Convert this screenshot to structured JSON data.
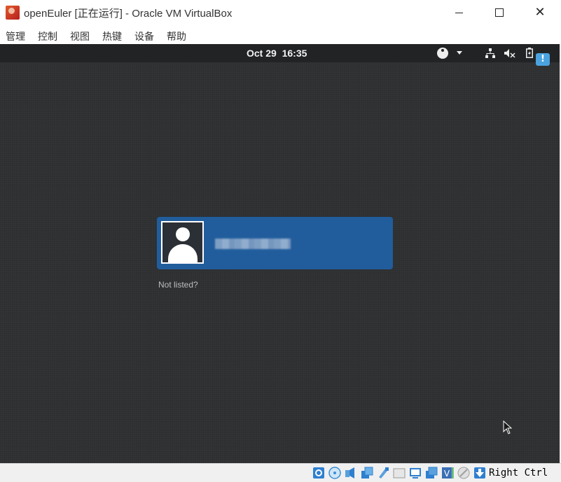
{
  "window": {
    "title": "openEuler [正在运行] - Oracle VM VirtualBox",
    "app_icon": "virtualbox-icon",
    "controls": [
      "minimize-icon",
      "maximize-icon",
      "close-icon"
    ],
    "close_glyph": "✕"
  },
  "menu": {
    "items": [
      "管理",
      "控制",
      "视图",
      "热键",
      "设备",
      "帮助"
    ]
  },
  "guest": {
    "top_bar": {
      "datetime": "Oct 29  16:35",
      "indicators": [
        "accessibility-icon",
        "network-icon",
        "volume-muted-icon",
        "battery-icon"
      ],
      "notification_badge": "!"
    },
    "login": {
      "user_name": "",
      "avatar": "user-avatar-icon",
      "not_listed": "Not listed?"
    },
    "colors": {
      "background": "#2d2f31",
      "top_bar": "#222325",
      "selected_user": "#215d9c"
    }
  },
  "status_bar": {
    "icons": [
      "hard-disk-icon",
      "optical-disk-icon",
      "audio-icon",
      "network-adapter-icon",
      "usb-icon",
      "shared-folder-icon",
      "display-icon",
      "video-capture-icon",
      "virtualization-icon",
      "mouse-integration-icon",
      "keyboard-capture-icon"
    ],
    "host_key": "Right Ctrl"
  }
}
